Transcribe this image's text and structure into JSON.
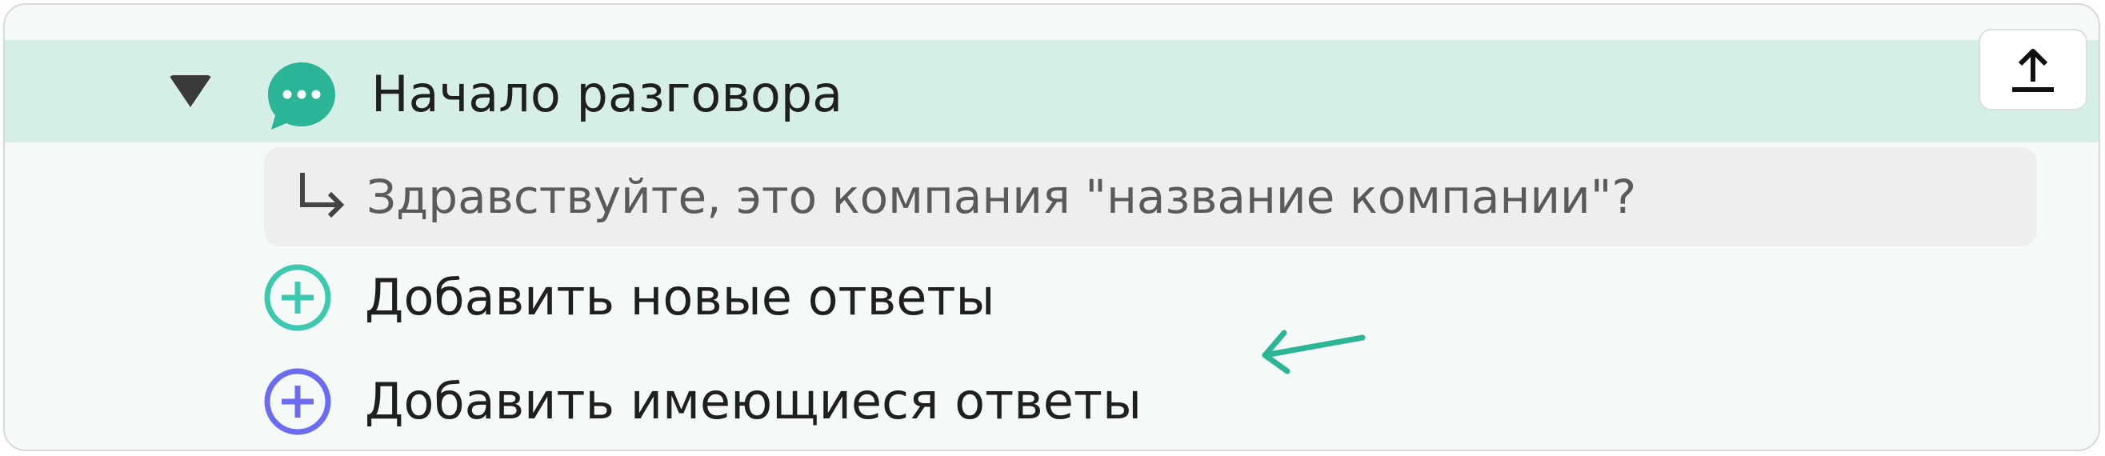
{
  "tree": {
    "node_title": "Начало разговора",
    "node_icon": "chat-bubble-icon",
    "export_icon": "upload-icon",
    "message_text": "Здравствуйте, это компания \"название компании\"?",
    "actions": {
      "add_new_label": "Добавить новые ответы",
      "add_existing_label": "Добавить имеющиеся ответы"
    }
  },
  "colors": {
    "header_bg": "#d6efe6",
    "accent_green": "#2bb596",
    "accent_teal": "#3dc9b0",
    "accent_purple": "#6c6cf2",
    "message_bg": "#eeeeee"
  }
}
